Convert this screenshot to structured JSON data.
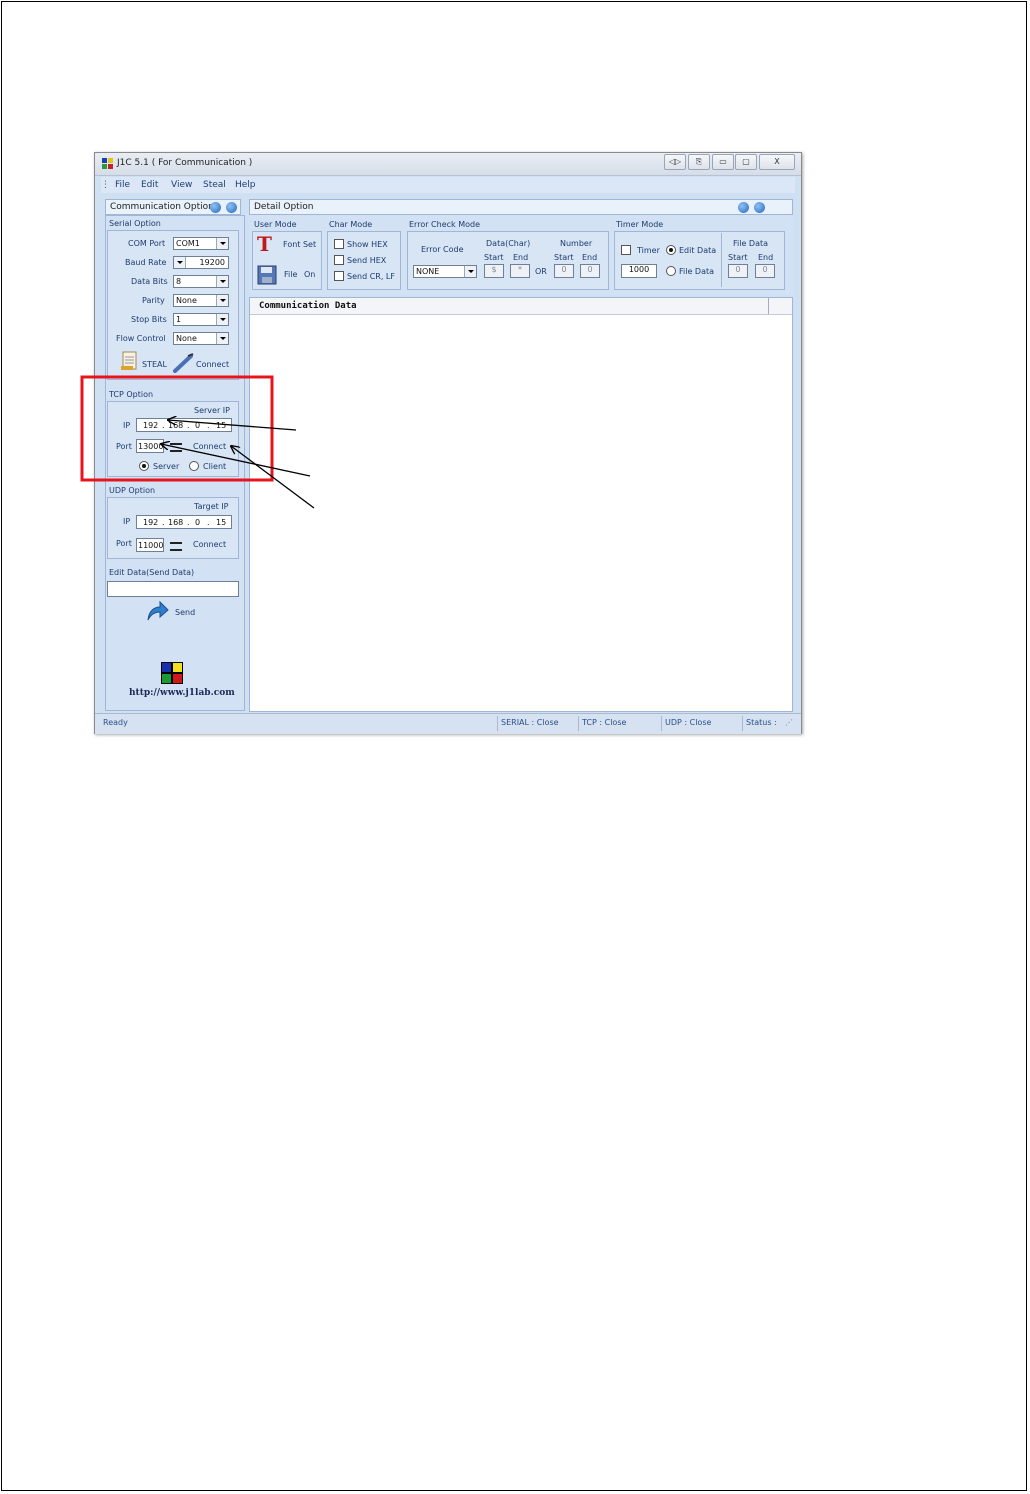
{
  "window": {
    "title": "J1C 5.1 ( For Communication )",
    "controls": {
      "restore": "◁▷",
      "export": "⎘",
      "minimize": "▭",
      "maximize": "▢",
      "close": "X"
    }
  },
  "menu": [
    "File",
    "Edit",
    "View",
    "Steal",
    "Help"
  ],
  "left": {
    "header": "Communication Option",
    "serial": {
      "title": "Serial Option",
      "com_port_label": "COM Port",
      "com_port": "COM1",
      "baud_label": "Baud Rate",
      "baud": "19200",
      "data_bits_label": "Data Bits",
      "data_bits": "8",
      "parity_label": "Parity",
      "parity": "None",
      "stop_bits_label": "Stop Bits",
      "stop_bits": "1",
      "flow_label": "Flow Control",
      "flow": "None",
      "steal_label": "STEAL",
      "connect_label": "Connect"
    },
    "tcp": {
      "title": "TCP Option",
      "server_ip_label": "Server IP",
      "ip_label": "IP",
      "ip": [
        "192",
        "168",
        "0",
        "15"
      ],
      "port_label": "Port",
      "port": "13000",
      "connect_label": "Connect",
      "server_label": "Server",
      "client_label": "Client"
    },
    "udp": {
      "title": "UDP Option",
      "target_ip_label": "Target IP",
      "ip_label": "IP",
      "ip": [
        "192",
        "168",
        "0",
        "15"
      ],
      "port_label": "Port",
      "port": "11000",
      "connect_label": "Connect"
    },
    "edit_label": "Edit Data(Send Data)",
    "send_label": "Send",
    "url": "http://www.j1lab.com"
  },
  "detail": {
    "header": "Detail Option",
    "user_mode": {
      "title": "User Mode",
      "font_set": "Font Set",
      "file": "File",
      "on": "On"
    },
    "char_mode": {
      "title": "Char Mode",
      "show_hex": "Show HEX",
      "send_hex": "Send HEX",
      "send_crlf": "Send CR, LF"
    },
    "error_check": {
      "title": "Error Check Mode",
      "error_code_label": "Error Code",
      "error_code": "NONE",
      "data_char": "Data(Char)",
      "number": "Number",
      "start": "Start",
      "end": "End",
      "or": "OR",
      "dc_start": "$",
      "dc_end": "*",
      "num_start": "0",
      "num_end": "0"
    },
    "timer": {
      "title": "Timer Mode",
      "timer_label": "Timer",
      "timer_value": "1000",
      "edit_data": "Edit Data",
      "file_data": "File Data",
      "file_data_title": "File Data",
      "start": "Start",
      "end": "End",
      "fd_start": "0",
      "fd_end": "0"
    },
    "comm_header": "Communication Data"
  },
  "status": {
    "ready": "Ready",
    "serial": "SERIAL : Close",
    "tcp": "TCP : Close",
    "udp": "UDP : Close",
    "status": "Status :"
  },
  "colors": {
    "highlight": "#e8141c",
    "window_bg": "#cfe0f3"
  }
}
